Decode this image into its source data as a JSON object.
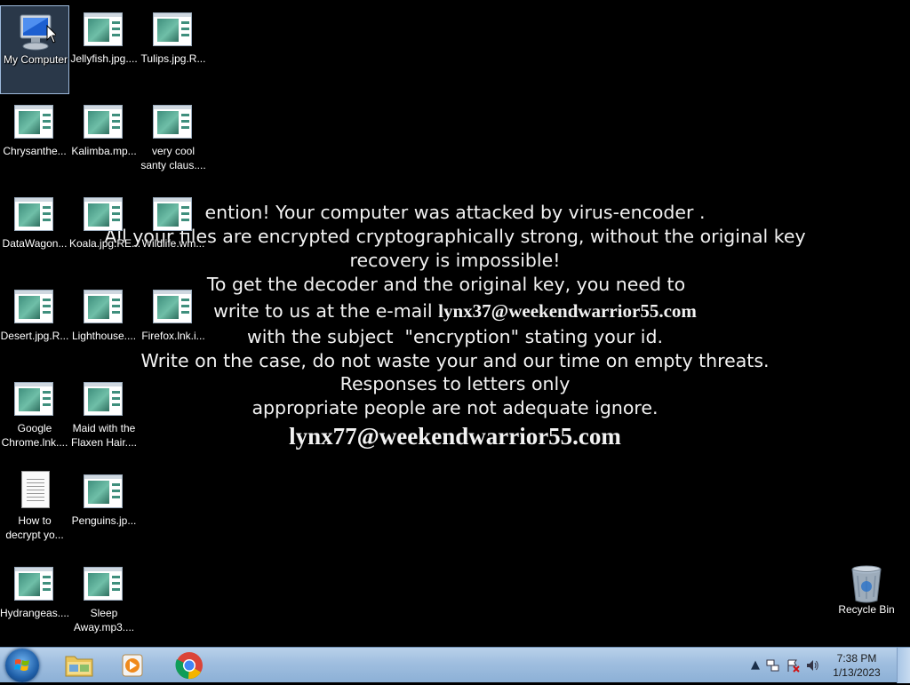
{
  "desktop": {
    "icons": [
      {
        "label": "My Computer",
        "type": "computer"
      },
      {
        "label": "Jellyfish.jpg....",
        "type": "image"
      },
      {
        "label": "Tulips.jpg.R...",
        "type": "image"
      },
      {
        "label": "Chrysanthe...",
        "type": "image"
      },
      {
        "label": "Kalimba.mp...",
        "type": "image"
      },
      {
        "label": "very cool\nsanty claus....",
        "type": "image"
      },
      {
        "label": "DataWagon...",
        "type": "image"
      },
      {
        "label": "Koala.jpg.RE...",
        "type": "image"
      },
      {
        "label": "Wildlife.wm...",
        "type": "image"
      },
      {
        "label": "Desert.jpg.R...",
        "type": "image"
      },
      {
        "label": "Lighthouse....",
        "type": "image"
      },
      {
        "label": "Firefox.lnk.i...",
        "type": "image"
      },
      {
        "label": "Google\nChrome.lnk....",
        "type": "image"
      },
      {
        "label": "Maid with the\nFlaxen Hair....",
        "type": "image"
      },
      {
        "label": "How to\ndecrypt yo...",
        "type": "document"
      },
      {
        "label": "Penguins.jp...",
        "type": "image"
      },
      {
        "label": "Hydrangeas....",
        "type": "image"
      },
      {
        "label": "Sleep\nAway.mp3....",
        "type": "image"
      },
      {
        "label": "Recycle Bin",
        "type": "recycle-bin"
      }
    ]
  },
  "ransom_note": {
    "line1": "ention! Your computer was attacked by virus-encoder .",
    "line2": "All your files are encrypted cryptographically strong, without the original key",
    "line3": "recovery is impossible!",
    "line4": "To get the decoder and the original key, you need to",
    "line5_prefix": "write to us at the e-mail ",
    "email1": "lynx37@weekendwarrior55.com",
    "line6": "with the subject  \"encryption\" stating your id.",
    "line7": "Write on the case, do not waste your and our time on empty threats.",
    "line8": "Responses to letters only",
    "line9": "appropriate people are not adequate ignore.",
    "email2": "lynx77@weekendwarrior55.com"
  },
  "taskbar": {
    "start_icon": "windows-logo-icon",
    "pinned": [
      {
        "name": "explorer",
        "icon": "folder-icon"
      },
      {
        "name": "media-player",
        "icon": "media-player-icon"
      },
      {
        "name": "chrome",
        "icon": "chrome-icon"
      }
    ],
    "tray": {
      "time": "7:38 PM",
      "date": "1/13/2023"
    }
  }
}
